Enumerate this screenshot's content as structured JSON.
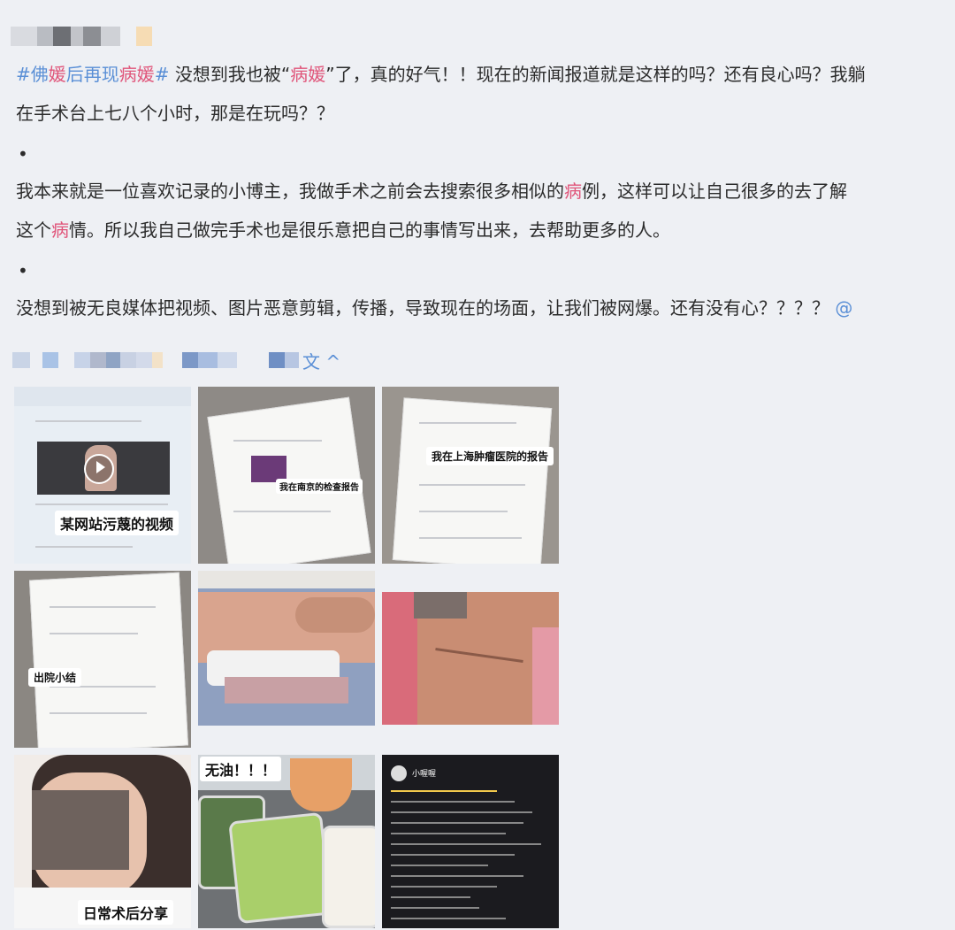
{
  "post": {
    "line1_prefix": "#佛",
    "line1_hl1": "媛",
    "line1_mid": "后再现",
    "line1_hl2": "病媛",
    "line1_tagend": "#",
    "line1_text1": " 没想到我也被“",
    "line1_hl3": "病媛",
    "line1_text2": "”了，真的好气！！现在的新闻报道就是这样的吗？还有良心吗？我躺",
    "line2": "在手术台上七八个小时，那是在玩吗？？",
    "bullet": "•",
    "line3_a": "我本来就是一位喜欢记录的小博主，我做手术之前会去搜索很多相似的",
    "line3_hl": "病",
    "line3_b": "例，这样可以让自己很多的去了解",
    "line4_a": "这个",
    "line4_hl": "病",
    "line4_b": "情。所以我自己做完手术也是很乐意把自己的事情写出来，去帮助更多的人。",
    "line5": "没想到被无良媒体把视频、图片恶意剪辑，传播，导致现在的场面，让我们被网爆。还有没有心？？？？",
    "at": "@",
    "expand_label": "文 ^"
  },
  "images": [
    {
      "caption": "某网站污蔑的视频"
    },
    {
      "caption": "我在南京的检查报告"
    },
    {
      "caption": "我在上海肿瘤医院的报告"
    },
    {
      "caption": "出院小结"
    },
    {
      "caption": ""
    },
    {
      "caption": ""
    },
    {
      "caption": "日常术后分享"
    },
    {
      "caption": "无油！！！"
    },
    {
      "caption": "小喔喔"
    }
  ],
  "colors": {
    "hashtag": "#5a8fd6",
    "highlight": "#e0557a",
    "background": "#eef0f4"
  }
}
